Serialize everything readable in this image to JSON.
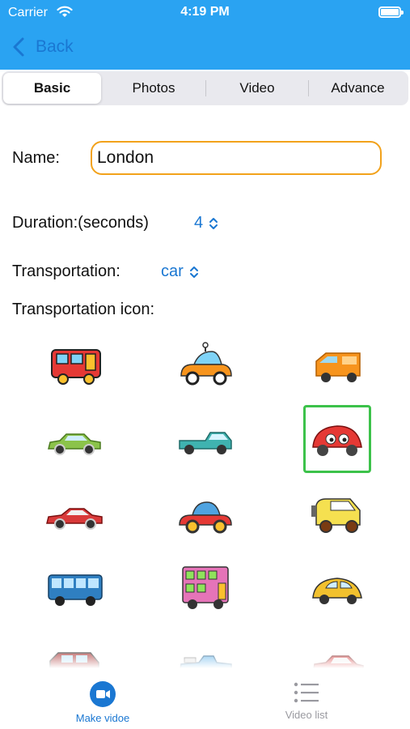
{
  "status": {
    "carrier": "Carrier",
    "time": "4:19 PM"
  },
  "nav": {
    "back_label": "Back"
  },
  "tabs": [
    {
      "label": "Basic",
      "active": true
    },
    {
      "label": "Photos",
      "active": false
    },
    {
      "label": "Video",
      "active": false
    },
    {
      "label": "Advance",
      "active": false
    }
  ],
  "form": {
    "name_label": "Name:",
    "name_value": "London",
    "duration_label": "Duration:(seconds)",
    "duration_value": "4",
    "transport_label": "Transportation:",
    "transport_value": "car",
    "icon_label": "Transportation icon:"
  },
  "icons": [
    {
      "name": "red-bus-icon",
      "color": "#e53935",
      "selected": false
    },
    {
      "name": "orange-wind-up-car-icon",
      "color": "#f7941d",
      "selected": false
    },
    {
      "name": "orange-van-icon",
      "color": "#f7941d",
      "selected": false
    },
    {
      "name": "green-sedan-icon",
      "color": "#8bc34a",
      "selected": false
    },
    {
      "name": "teal-pickup-truck-icon",
      "color": "#3fb3b0",
      "selected": false
    },
    {
      "name": "red-cartoon-beetle-icon",
      "color": "#e53935",
      "selected": true
    },
    {
      "name": "red-sports-car-icon",
      "color": "#d93a3a",
      "selected": false
    },
    {
      "name": "red-cartoon-car-icon",
      "color": "#e53935",
      "selected": false
    },
    {
      "name": "yellow-jeep-icon",
      "color": "#f5e050",
      "selected": false
    },
    {
      "name": "blue-city-bus-icon",
      "color": "#2f7fc1",
      "selected": false
    },
    {
      "name": "pink-double-decker-bus-icon",
      "color": "#e574b8",
      "selected": false
    },
    {
      "name": "yellow-beetle-icon",
      "color": "#f2c12e",
      "selected": false
    },
    {
      "name": "dark-red-suv-icon",
      "color": "#a83232",
      "selected": false
    },
    {
      "name": "blue-convertible-icon",
      "color": "#5ab0e8",
      "selected": false
    },
    {
      "name": "red-hatchback-icon",
      "color": "#d93a3a",
      "selected": false
    }
  ],
  "tabbar": [
    {
      "label": "Make vidoe",
      "icon": "video-camera-icon",
      "active": true
    },
    {
      "label": "Video list",
      "icon": "list-icon",
      "active": false
    }
  ],
  "colors": {
    "accent": "#2aa3f2",
    "link": "#1a77d2",
    "input_border": "#f2a21b",
    "selection": "#3cc24a"
  }
}
